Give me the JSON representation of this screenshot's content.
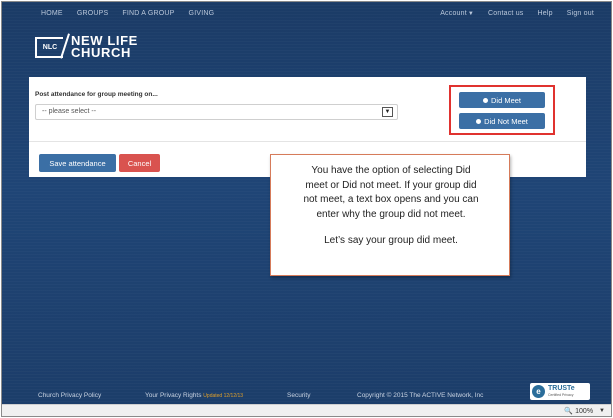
{
  "topnav": {
    "left": [
      "HOME",
      "GROUPS",
      "FIND A GROUP",
      "GIVING"
    ],
    "account": "Account",
    "right": [
      "Contact us",
      "Help",
      "Sign out"
    ]
  },
  "logo": {
    "badge": "NLC",
    "line1": "NEW LIFE",
    "line2": "CHURCH"
  },
  "form": {
    "label": "Post attendance for group meeting on...",
    "select_value": "-- please select --",
    "did_meet": "Did Meet",
    "did_not_meet": "Did Not Meet",
    "save": "Save attendance",
    "cancel": "Cancel"
  },
  "callout": {
    "line1": "You have the option of selecting Did",
    "line2": "meet or Did not meet.  If your group did",
    "line3": "not meet, a text box opens and you can",
    "line4": "enter why the group did not meet.",
    "line5": "Let’s say your group did meet."
  },
  "footer": {
    "privacy_policy": "Church Privacy Policy",
    "privacy_rights": "Your Privacy Rights",
    "updated": "Updated 12/12/13",
    "security": "Security",
    "copyright": "Copyright © 2015 The ACTIVE Network, Inc",
    "truste": "TRUSTe",
    "truste_sub": "Certified Privacy"
  },
  "statusbar": {
    "zoom": "100%"
  },
  "colors": {
    "accent_blue": "#3b6fa5",
    "cancel_red": "#d9534f",
    "highlight_red": "#e0322f",
    "background": "#1d3f6b"
  }
}
